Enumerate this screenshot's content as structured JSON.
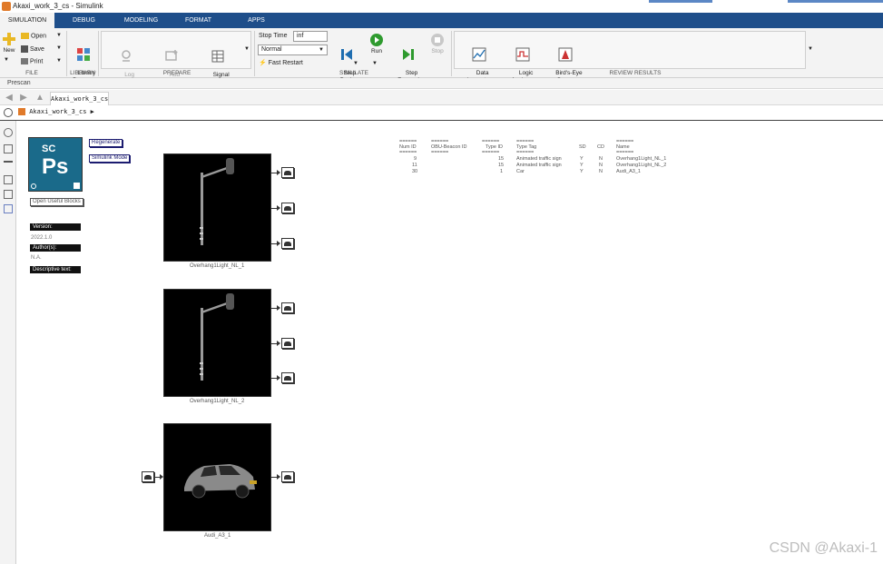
{
  "window": {
    "title": "Akaxi_work_3_cs - Simulink"
  },
  "tabs": [
    {
      "label": "SIMULATION",
      "active": true
    },
    {
      "label": "DEBUG",
      "active": false
    },
    {
      "label": "MODELING",
      "active": false
    },
    {
      "label": "FORMAT",
      "active": false
    },
    {
      "label": "APPS",
      "active": false
    }
  ],
  "ribbon": {
    "file": {
      "label": "FILE",
      "new": "New",
      "open": "Open",
      "save": "Save",
      "print": "Print"
    },
    "library": {
      "label": "LIBRARY",
      "browser": "Library\nBrowser"
    },
    "prepare": {
      "label": "PREPARE",
      "log_signals": "Log\nSignals",
      "add_viewer": "Add\nViewer",
      "signal_table": "Signal\nTable"
    },
    "simulate": {
      "label": "SIMULATE",
      "stop_time_label": "Stop Time",
      "stop_time_value": "inf",
      "mode_value": "Normal",
      "fast_restart": "Fast Restart",
      "step_back": "Step\nBack",
      "run": "Run",
      "step_forward": "Step\nForward",
      "stop": "Stop"
    },
    "review": {
      "label": "REVIEW RESULTS",
      "data_inspector": "Data\nInspector",
      "logic_analyzer": "Logic\nAnalyzer",
      "birds_eye": "Bird's-Eye\nScope"
    }
  },
  "prescan_bar": {
    "label": "Prescan"
  },
  "model_tab": {
    "label": "Akaxi_work_3_cs"
  },
  "breadcrumb": {
    "label": "Akaxi_work_3_cs"
  },
  "prescan_panel": {
    "logo_sc": "SC",
    "logo_ps": "Ps",
    "open_blocks": "Open Useful Blocks",
    "regenerate": "Regenerate",
    "simulink_mode": "Simulink Mode",
    "version_label": "Version:",
    "version_value": "2022.1.0",
    "author_label": "Author(s):",
    "author_value": "N.A.",
    "description_label": "Descriptive text:"
  },
  "blocks": [
    {
      "caption": "Overhang1Light_NL_1"
    },
    {
      "caption": "Overhang1Light_NL_2"
    },
    {
      "caption": "Audi_A3_1"
    }
  ],
  "object_table": {
    "separator": "======",
    "headers": [
      "Num ID",
      "OBU-Beacon ID",
      "Type ID",
      "Type Tag",
      "SD",
      "CD",
      "Name"
    ],
    "rows": [
      [
        "9",
        "",
        "15",
        "Animated traffic sign",
        "Y",
        "N",
        "Overhang1Light_NL_1"
      ],
      [
        "11",
        "",
        "15",
        "Animated traffic sign",
        "Y",
        "N",
        "Overhang1Light_NL_2"
      ],
      [
        "30",
        "",
        "1",
        "Car",
        "Y",
        "N",
        "Audi_A3_1"
      ]
    ]
  },
  "watermark": "CSDN @Akaxi-1",
  "colors": {
    "tab_bar": "#1e4e8a",
    "ribbon_bg": "#f3f3f3",
    "run_green": "#2e9a2e",
    "logo_teal": "#1a6a8a"
  }
}
